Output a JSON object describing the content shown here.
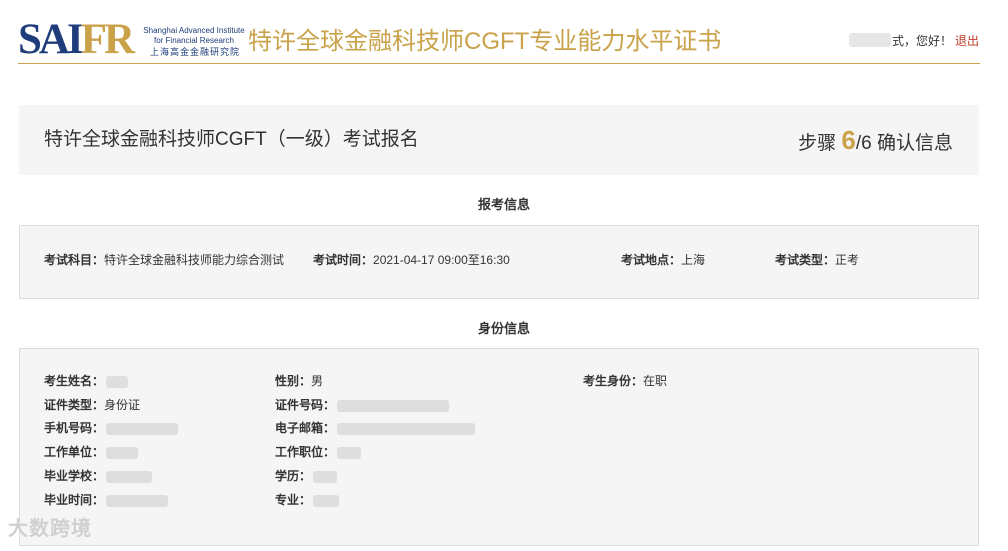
{
  "header": {
    "logo": {
      "mark_left": "SAI",
      "mark_right": "FR",
      "sub_line1": "Shanghai Advanced Institute",
      "sub_line2": "for Financial Research",
      "sub_cn": "上海高金金融研究院"
    },
    "title": "特许全球金融科技师CGFT专业能力水平证书",
    "greeting": "式，您好！",
    "logout": "退出"
  },
  "title_panel": {
    "title": "特许全球金融科技师CGFT（一级）考试报名",
    "step_prefix": "步骤 ",
    "step_current": "6",
    "step_total": "/6 确认信息"
  },
  "exam_section": {
    "heading": "报考信息",
    "fields": [
      {
        "label": "考试科目：",
        "value": "特许全球金融科技师能力综合测试"
      },
      {
        "label": "考试时间：",
        "value": "2021-04-17 09:00至16:30"
      },
      {
        "label": "考试地点：",
        "value": "上海"
      },
      {
        "label": "考试类型：",
        "value": "正考"
      }
    ]
  },
  "identity_section": {
    "heading": "身份信息",
    "fields": [
      {
        "label": "考生姓名：",
        "value": ""
      },
      {
        "label": "性别：",
        "value": "男"
      },
      {
        "label": "考生身份：",
        "value": "在职"
      },
      {
        "label": "证件类型：",
        "value": "身份证"
      },
      {
        "label": "证件号码：",
        "value": ""
      },
      {
        "label": "手机号码：",
        "value": ""
      },
      {
        "label": "电子邮箱：",
        "value": ""
      },
      {
        "label": "工作单位：",
        "value": ""
      },
      {
        "label": "工作职位：",
        "value": ""
      },
      {
        "label": "毕业学校：",
        "value": ""
      },
      {
        "label": "学历：",
        "value": ""
      },
      {
        "label": "毕业时间：",
        "value": ""
      },
      {
        "label": "专业：",
        "value": ""
      }
    ]
  },
  "watermark": "大数跨境"
}
